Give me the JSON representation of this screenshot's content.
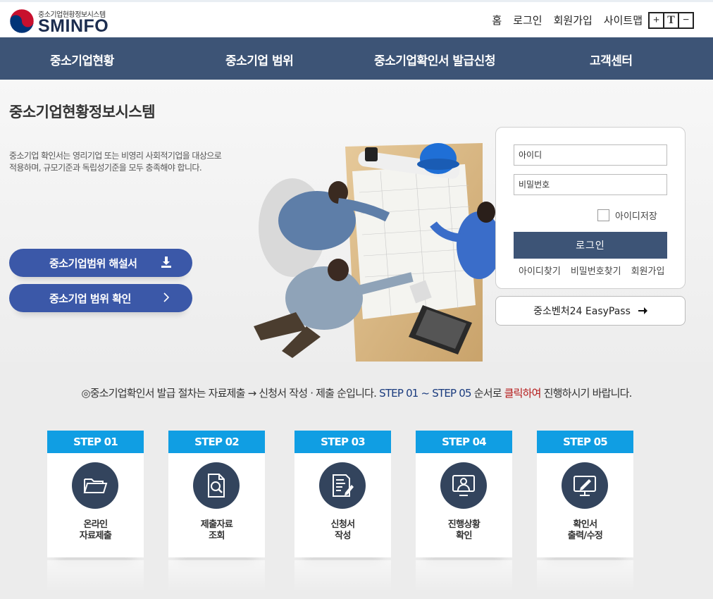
{
  "brand": {
    "subtitle": "중소기업현황정보시스템",
    "name": "SMINFO"
  },
  "util_nav": [
    "홈",
    "로그인",
    "회원가입",
    "사이트맵"
  ],
  "font_controls": [
    "+",
    "T",
    "−"
  ],
  "main_nav": [
    "중소기업현황",
    "중소기업 범위",
    "중소기업확인서 발급신청",
    "고객센터"
  ],
  "hero": {
    "title": "중소기업현황정보시스템",
    "description": "중소기업 확인서는 영리기업 또는 비영리 사회적기업을 대상으로 적용하며, 규모기준과 독립성기준을 모두 충족해야 합니다.",
    "buttons": [
      "중소기업범위 해설서",
      "중소기업 범위 확인"
    ]
  },
  "login": {
    "id_placeholder": "아이디",
    "pw_placeholder": "비밀번호",
    "save_id": "아이디저장",
    "login_button": "로그인",
    "links": [
      "아이디찾기",
      "비밀번호찾기",
      "회원가입"
    ],
    "easypass": "중소벤처24 EasyPass"
  },
  "notice": {
    "prefix": "◎중소기업확인서 발급 절차는 자료제출 → 신청서 작성 · 제출 순입니다. ",
    "steps_range": "STEP 01 ~ STEP 05",
    "middle": " 순서로 ",
    "click": "클릭하여",
    "suffix": " 진행하시기 바랍니다."
  },
  "steps": [
    {
      "label": "STEP 01",
      "line1": "온라인",
      "line2": "자료제출",
      "icon": "folder-icon"
    },
    {
      "label": "STEP 02",
      "line1": "제출자료",
      "line2": "조회",
      "icon": "document-search-icon"
    },
    {
      "label": "STEP 03",
      "line1": "신청서",
      "line2": "작성",
      "icon": "document-pen-icon"
    },
    {
      "label": "STEP 04",
      "line1": "진행상황",
      "line2": "확인",
      "icon": "monitor-user-icon"
    },
    {
      "label": "STEP 05",
      "line1": "확인서",
      "line2": "출력/수정",
      "icon": "monitor-edit-icon"
    }
  ],
  "colors": {
    "nav": "#3d5476",
    "step_header": "#109ee3",
    "pill": "#3b58a8",
    "icon_circle": "#33445d"
  }
}
